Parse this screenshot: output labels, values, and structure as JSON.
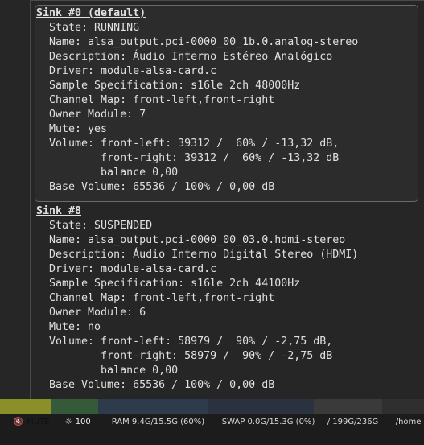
{
  "popup": {
    "sinks": [
      {
        "title": "Sink #0 (default)",
        "lines": [
          "  State: RUNNING",
          "  Name: alsa_output.pci-0000_00_1b.0.analog-stereo",
          "  Description: Áudio Interno Estéreo Analógico",
          "  Driver: module-alsa-card.c",
          "  Sample Specification: s16le 2ch 48000Hz",
          "  Channel Map: front-left,front-right",
          "  Owner Module: 7",
          "  Mute: yes",
          "  Volume: front-left: 39312 /  60% / -13,32 dB,",
          "          front-right: 39312 /  60% / -13,32 dB",
          "          balance 0,00",
          "  Base Volume: 65536 / 100% / 0,00 dB"
        ]
      },
      {
        "title": "Sink #8",
        "lines": [
          "  State: SUSPENDED",
          "  Name: alsa_output.pci-0000_00_03.0.hdmi-stereo",
          "  Description: Áudio Interno Digital Stereo (HDMI)",
          "  Driver: module-alsa-card.c",
          "  Sample Specification: s16le 2ch 44100Hz",
          "  Channel Map: front-left,front-right",
          "  Owner Module: 6",
          "  Mute: no",
          "  Volume: front-left: 58979 /  90% / -2,75 dB,",
          "          front-right: 58979 /  90% / -2,75 dB",
          "          balance 0,00",
          "  Base Volume: 65536 / 100% / 0,00 dB"
        ]
      }
    ]
  },
  "statusbar": {
    "mute_icon": "speaker-muted-icon",
    "mute_label": "MUTE",
    "brightness_icon": "sun-icon",
    "brightness_value": "100",
    "ram": "RAM 9.4G/15.5G (60%)",
    "swap": "SWAP 0.0G/15.3G (0%)",
    "disk": "/ 199G/236G",
    "home": "/home"
  }
}
